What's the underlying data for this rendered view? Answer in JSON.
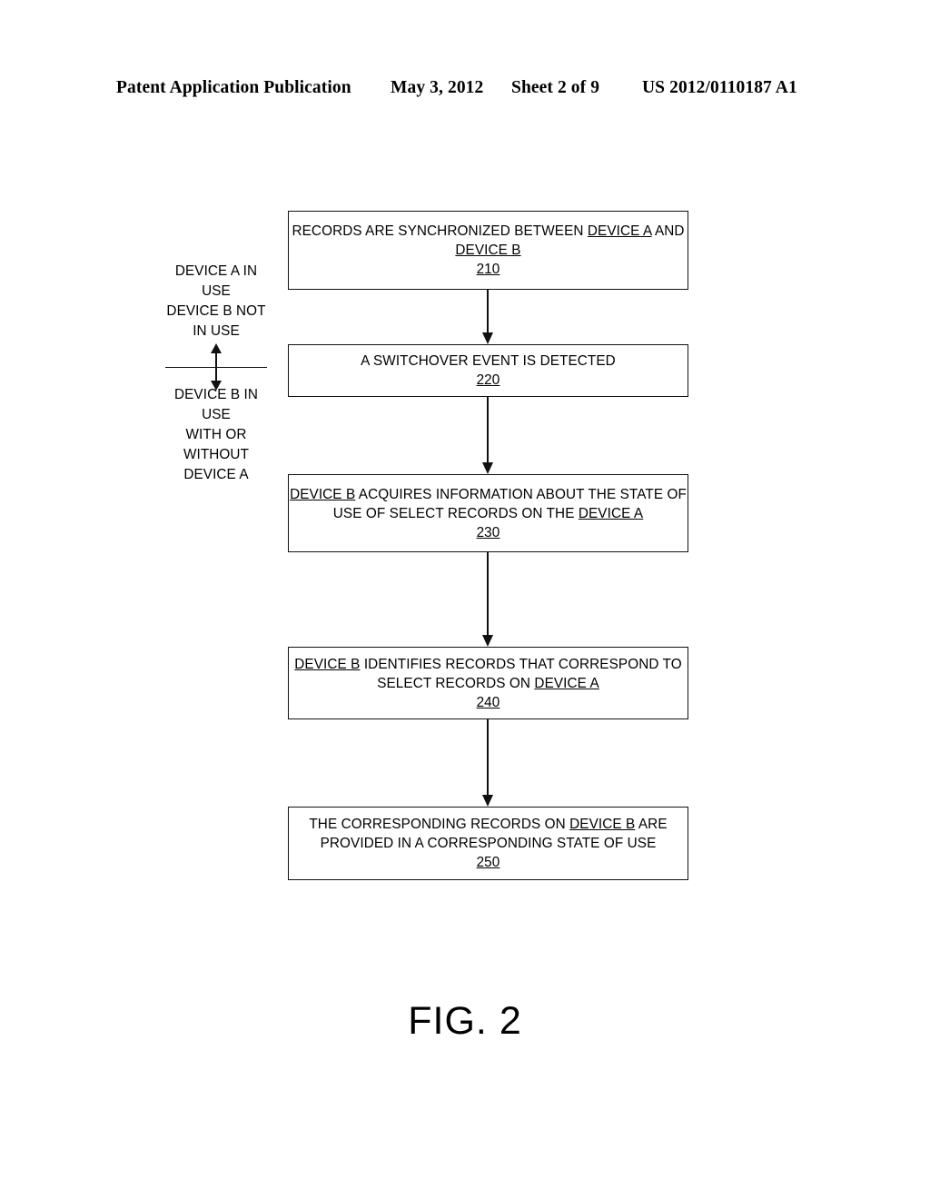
{
  "header": {
    "publication": "Patent Application Publication",
    "date": "May 3, 2012",
    "sheet": "Sheet 2 of 9",
    "pub_number": "US 2012/0110187 A1"
  },
  "figure": {
    "caption": "FIG. 2",
    "state_note_upper": {
      "lines": [
        "DEVICE A IN",
        "USE",
        "DEVICE B NOT",
        "IN USE"
      ]
    },
    "state_note_lower": {
      "lines": [
        "DEVICE B IN",
        "USE",
        "WITH OR",
        "WITHOUT",
        "DEVICE A"
      ]
    },
    "steps": [
      {
        "ref": "210",
        "lines": [
          "RECORDS ARE SYNCHRONIZED BETWEEN DEVICE A AND",
          "DEVICE B"
        ],
        "underlined_terms": [
          "DEVICE A",
          "DEVICE B"
        ],
        "full_text": "RECORDS ARE SYNCHRONIZED BETWEEN DEVICE A AND DEVICE B"
      },
      {
        "ref": "220",
        "lines": [
          "A SWITCHOVER EVENT IS DETECTED"
        ],
        "underlined_terms": [],
        "full_text": "A SWITCHOVER EVENT IS DETECTED"
      },
      {
        "ref": "230",
        "lines": [
          "DEVICE B ACQUIRES INFORMATION ABOUT THE STATE OF",
          "USE OF SELECT RECORDS  ON THE DEVICE A"
        ],
        "underlined_terms": [
          "DEVICE B",
          "DEVICE A"
        ],
        "full_text": "DEVICE B ACQUIRES INFORMATION ABOUT THE STATE OF USE OF SELECT RECORDS  ON THE DEVICE A"
      },
      {
        "ref": "240",
        "lines": [
          "DEVICE B IDENTIFIES RECORDS  THAT CORRESPOND TO",
          "SELECT RECORDS ON DEVICE A"
        ],
        "underlined_terms": [
          "DEVICE B",
          "DEVICE A"
        ],
        "full_text": "DEVICE B IDENTIFIES RECORDS  THAT CORRESPOND TO SELECT RECORDS ON DEVICE A"
      },
      {
        "ref": "250",
        "lines": [
          "THE CORRESPONDING RECORDS  ON DEVICE B ARE",
          "PROVIDED IN A CORRESPONDING STATE OF USE"
        ],
        "underlined_terms": [
          "DEVICE B"
        ],
        "full_text": "THE CORRESPONDING RECORDS  ON DEVICE B ARE PROVIDED IN A CORRESPONDING STATE OF USE"
      }
    ]
  },
  "colors": {
    "ink": "#111111",
    "paper": "#ffffff"
  }
}
